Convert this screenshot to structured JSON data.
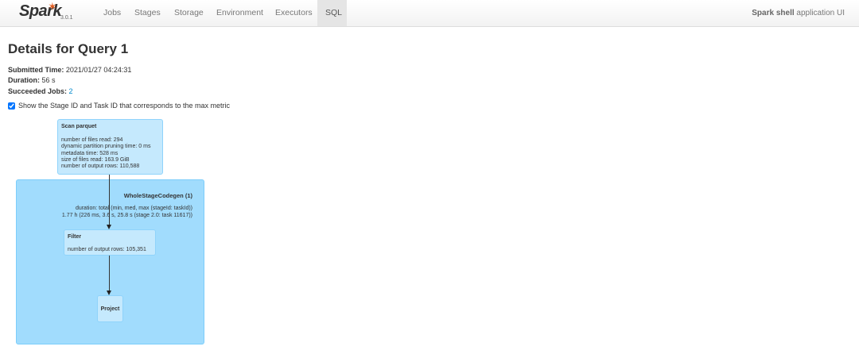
{
  "nav": {
    "brand": "Spark",
    "version": "3.0.1",
    "tabs": [
      "Jobs",
      "Stages",
      "Storage",
      "Environment",
      "Executors",
      "SQL"
    ],
    "active_tab": "SQL",
    "app_name": "Spark shell",
    "app_suffix": "application UI"
  },
  "page": {
    "title": "Details for Query 1",
    "submitted_label": "Submitted Time:",
    "submitted_value": "2021/01/27 04:24:31",
    "duration_label": "Duration:",
    "duration_value": "56 s",
    "jobs_label": "Succeeded Jobs:",
    "jobs_value": "2",
    "checkbox_label": "Show the Stage ID and Task ID that corresponds to the max metric"
  },
  "plan": {
    "scan": {
      "title": "Scan parquet",
      "metrics": [
        "number of files read: 294",
        "dynamic partition pruning time: 0 ms",
        "metadata time: 528 ms",
        "size of files read: 163.9 GiB",
        "number of output rows: 110,588"
      ]
    },
    "codegen": {
      "title": "WholeStageCodegen (1)",
      "line1": "duration: total (min, med, max (stageId: taskId))",
      "line2": "1.77 h (226 ms, 3.6 s, 25.8 s (stage 2.0: task 11617))"
    },
    "filter": {
      "title": "Filter",
      "metric": "number of output rows: 105,351"
    },
    "project": {
      "title": "Project"
    }
  }
}
